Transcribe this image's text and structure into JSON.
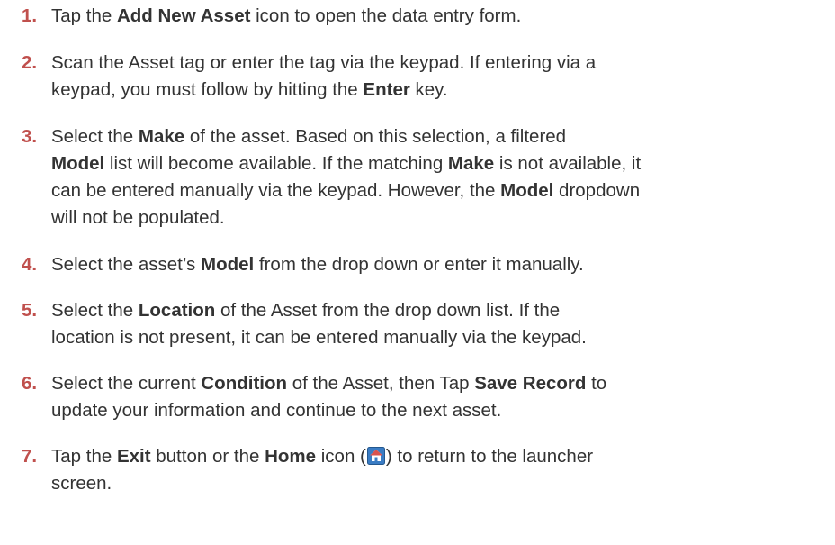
{
  "steps": [
    {
      "num": "1.",
      "parts": [
        "Tap the ",
        "Add New Asset",
        " icon to open the data entry form."
      ]
    },
    {
      "num": "2.",
      "lines": [
        "Scan the Asset tag or enter the tag via the keypad. If entering via a",
        "keypad, you must follow by hitting the "
      ],
      "bold": "Enter",
      "tail": " key."
    },
    {
      "num": "3.",
      "a": "Select the ",
      "b": "Make",
      "c": " of the asset. Based on this selection, a filtered",
      "d": "Model",
      "e": " list will become available. If the matching ",
      "f": "Make",
      "g": " is not available, it",
      "h": "can be entered manually via the keypad. However, the ",
      "i": "Model",
      "j": " dropdown",
      "k": "will not be populated."
    },
    {
      "num": "4.",
      "a": "Select the asset’s ",
      "b": "Model",
      "c": " from the drop down or enter it manually."
    },
    {
      "num": "5.",
      "a": "Select the ",
      "b": "Location",
      "c": " of the Asset from the drop down list. If the",
      "d": "location is not present, it can be entered manually via the keypad."
    },
    {
      "num": "6.",
      "a": "Select the current ",
      "b": "Condition",
      "c": " of the Asset, then Tap ",
      "d": "Save Record",
      "e": " to",
      "f": "update your information and continue to the next asset."
    },
    {
      "num": "7.",
      "a": "Tap the ",
      "b": "Exit",
      "c": " button or the ",
      "d": "Home",
      "e": " icon (",
      "f": ") to return to the launcher",
      "g": "screen."
    }
  ],
  "colors": {
    "number": "#c0504d",
    "text": "#333333",
    "home_icon_blue": "#3a7cc4",
    "home_icon_roof": "#d9534f"
  },
  "icons": [
    "home-icon"
  ]
}
